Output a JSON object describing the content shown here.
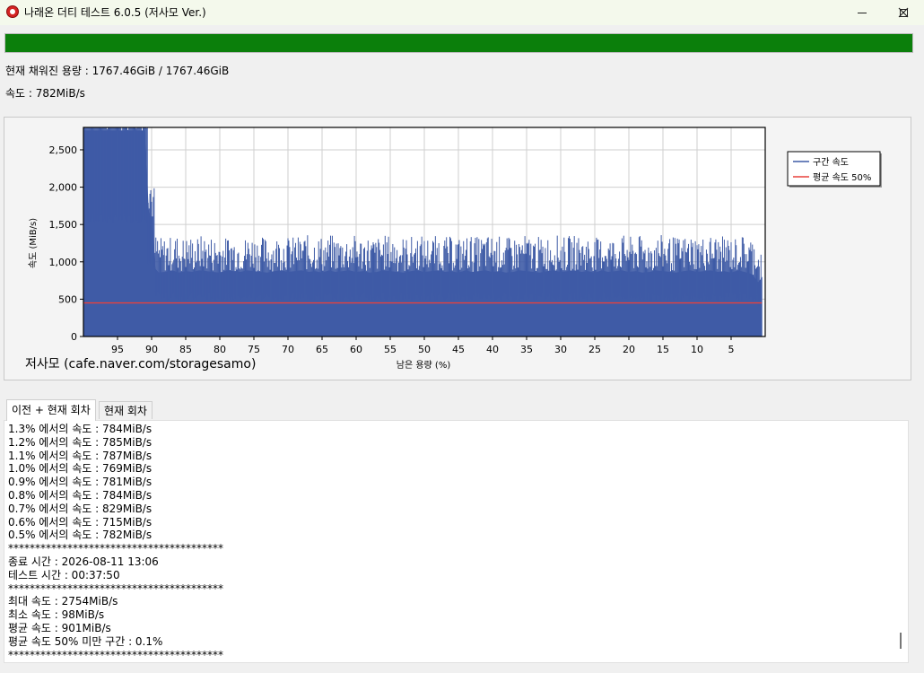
{
  "window": {
    "title": "나래온 더티 테스트 6.0.5 (저사모 Ver.)",
    "minimize_icon": "minimize-icon",
    "maximize_icon": "maximize-icon",
    "close_icon": "close-icon"
  },
  "progress": {
    "fraction": 1.0,
    "color": "#0b7f0b"
  },
  "status": {
    "capacity_text": "현재 채워진 용량 : 1767.46GiB / 1767.46GiB",
    "speed_text": "속도 : 782MiB/s"
  },
  "chart_data": {
    "type": "area",
    "ylabel": "속도 (MiB/s)",
    "xlabel": "남은 용량 (%)",
    "watermark": "저사모 (cafe.naver.com/storagesamo)",
    "xlim": [
      100,
      0
    ],
    "ylim": [
      0,
      2800
    ],
    "x_reversed": true,
    "grid": true,
    "yticks": [
      0,
      500,
      1000,
      1500,
      2000,
      2500
    ],
    "ytick_labels": [
      "0",
      "500",
      "1,000",
      "1,500",
      "2,000",
      "2,500"
    ],
    "xticks": [
      95,
      90,
      85,
      80,
      75,
      70,
      65,
      60,
      55,
      50,
      45,
      40,
      35,
      30,
      25,
      20,
      15,
      10,
      5
    ],
    "legend_position": "right",
    "series": [
      {
        "name": "구간 속도",
        "color": "#3f5ba6",
        "x": [
          100,
          99,
          98,
          97,
          96,
          95,
          94,
          93,
          92,
          91,
          90.5,
          90,
          89.5,
          89,
          88,
          87,
          86,
          85,
          84,
          83,
          82,
          81,
          80,
          79,
          78,
          77,
          76,
          75,
          74,
          73,
          72,
          71,
          70,
          69,
          68,
          67,
          66,
          65,
          64,
          63,
          62,
          61,
          60,
          59,
          58,
          57,
          56,
          55,
          54,
          53,
          52,
          51,
          50,
          49,
          48,
          47,
          46,
          45,
          44,
          43,
          42,
          41,
          40,
          39,
          38,
          37,
          36,
          35,
          34,
          33,
          32,
          31,
          30,
          29,
          28,
          27,
          26,
          25,
          24,
          23,
          22,
          21,
          20,
          19,
          18,
          17,
          16,
          15,
          14,
          13,
          12,
          11,
          10,
          9,
          8,
          7,
          6,
          5,
          4,
          3,
          2,
          1,
          0.5
        ],
        "values": [
          2754,
          2754,
          2754,
          2754,
          2754,
          2754,
          2754,
          2754,
          2754,
          2754,
          1700,
          1550,
          900,
          850,
          860,
          880,
          850,
          870,
          860,
          880,
          870,
          860,
          850,
          880,
          870,
          860,
          880,
          870,
          860,
          850,
          870,
          880,
          860,
          870,
          880,
          860,
          870,
          850,
          880,
          860,
          870,
          880,
          860,
          870,
          850,
          860,
          880,
          870,
          860,
          850,
          870,
          880,
          860,
          870,
          880,
          860,
          870,
          850,
          880,
          860,
          870,
          880,
          860,
          870,
          850,
          860,
          880,
          870,
          860,
          850,
          870,
          880,
          860,
          870,
          880,
          860,
          870,
          850,
          880,
          860,
          870,
          880,
          860,
          870,
          850,
          860,
          880,
          870,
          860,
          850,
          870,
          880,
          860,
          870,
          880,
          860,
          870,
          850,
          880,
          860,
          829,
          715,
          782
        ]
      },
      {
        "name": "평균 속도 50%",
        "color": "#e8413c",
        "x": [
          100,
          0.5
        ],
        "values": [
          450,
          450
        ]
      }
    ]
  },
  "tabs": [
    {
      "label": "이전 + 현재 회차",
      "active": true
    },
    {
      "label": "현재 회차",
      "active": false
    }
  ],
  "log": [
    "1.3% 에서의 속도 : 784MiB/s",
    "1.2% 에서의 속도 : 785MiB/s",
    "1.1% 에서의 속도 : 787MiB/s",
    "1.0% 에서의 속도 : 769MiB/s",
    "0.9% 에서의 속도 : 781MiB/s",
    "0.8% 에서의 속도 : 784MiB/s",
    "0.7% 에서의 속도 : 829MiB/s",
    "0.6% 에서의 속도 : 715MiB/s",
    "0.5% 에서의 속도 : 782MiB/s",
    "****************************************",
    "종료 시간 : 2026-08-11 13:06",
    "테스트 시간 : 00:37:50",
    "****************************************",
    "최대 속도 : 2754MiB/s",
    "최소 속도 : 98MiB/s",
    "평균 속도 : 901MiB/s",
    "평균 속도 50% 미만 구간 : 0.1%",
    "****************************************"
  ]
}
